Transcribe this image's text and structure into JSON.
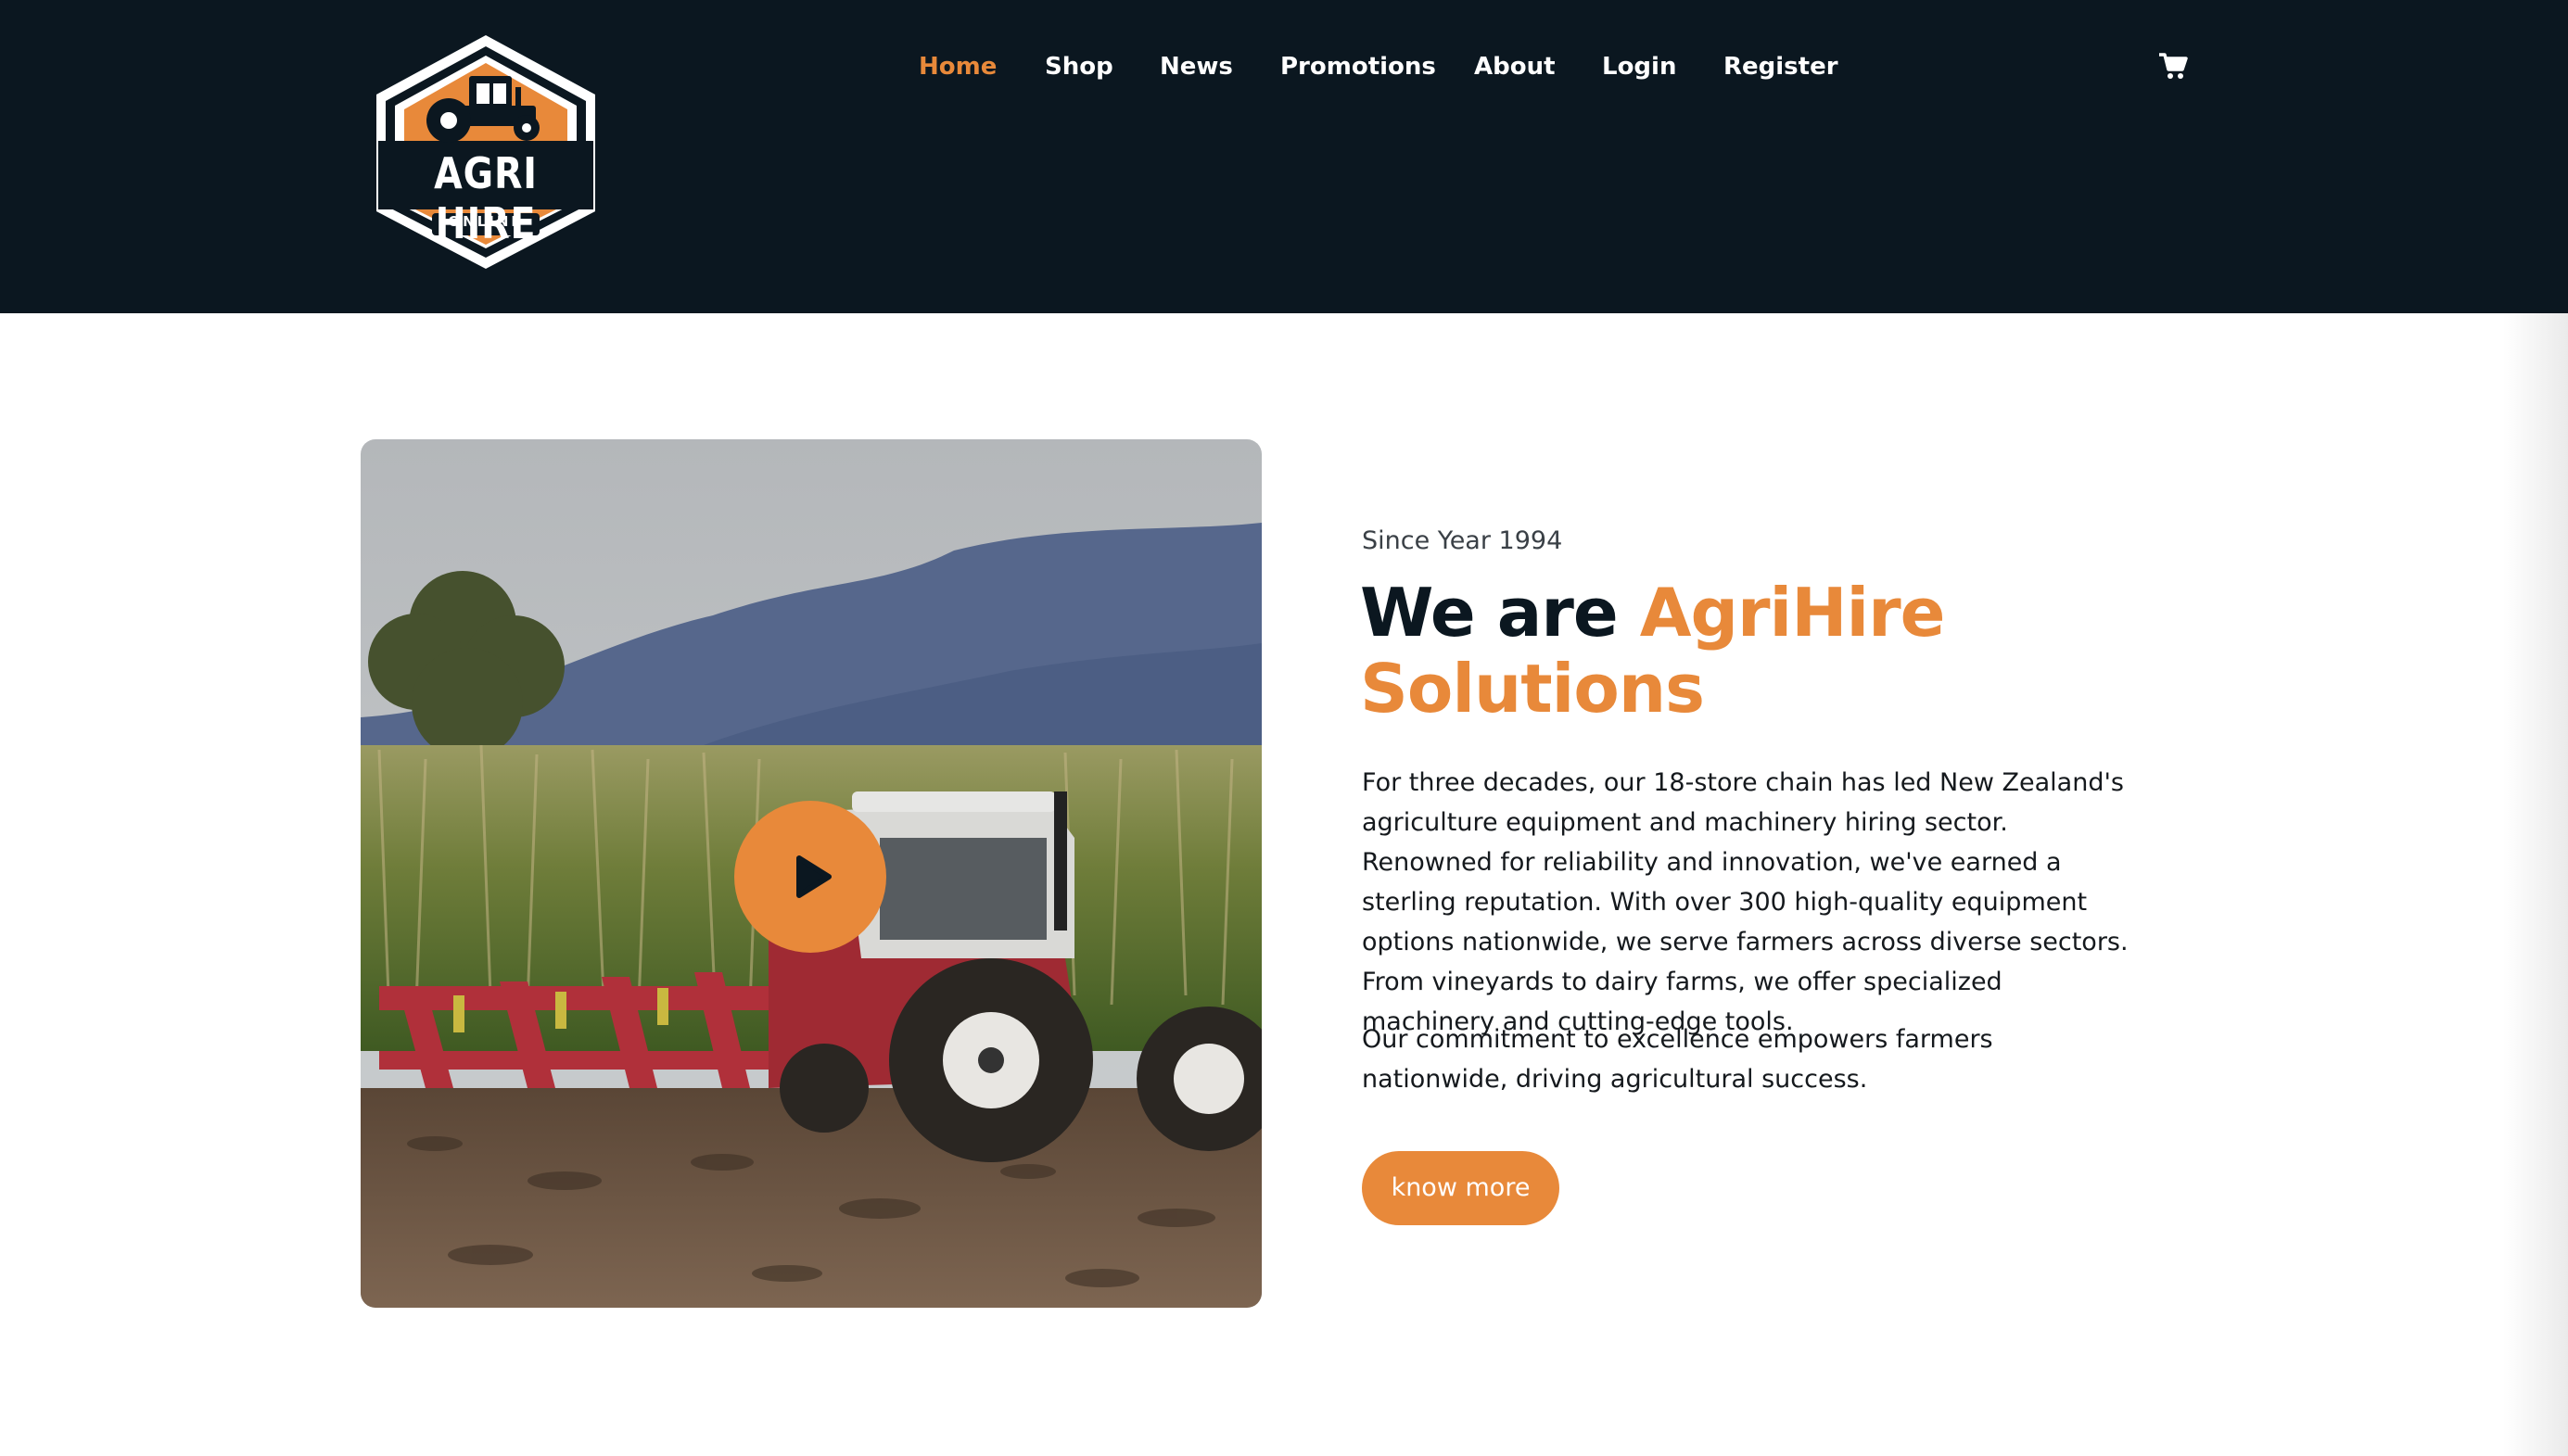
{
  "brand": {
    "name": "AGRI HIRE",
    "tagline": "ONLINE",
    "accent_color": "#e8893a",
    "header_bg": "#0b1720"
  },
  "nav": {
    "items": [
      {
        "label": "Home",
        "active": true
      },
      {
        "label": "Shop"
      },
      {
        "label": "News"
      },
      {
        "label": "Promotions"
      },
      {
        "label": "About"
      },
      {
        "label": "Login"
      },
      {
        "label": "Register"
      }
    ],
    "cart_icon": "cart-icon"
  },
  "hero": {
    "image_subject": "red and white tractor pulling a plough through a field in front of a corn crop and hills",
    "play_icon": "play-icon",
    "eyebrow": "Since Year 1994",
    "headline_part1": "We are ",
    "headline_part2": "AgriHire Solutions",
    "paragraph1": "For three decades, our 18-store chain has led New Zealand's agriculture equipment and machinery hiring sector. Renowned for reliability and innovation, we've earned a sterling reputation. With over 300 high-quality equipment options nationwide, we serve farmers across diverse sectors. From vineyards to dairy farms, we offer specialized machinery and cutting-edge tools.",
    "paragraph2": "Our commitment to excellence empowers farmers nationwide, driving agricultural success.",
    "cta_label": "know more"
  }
}
